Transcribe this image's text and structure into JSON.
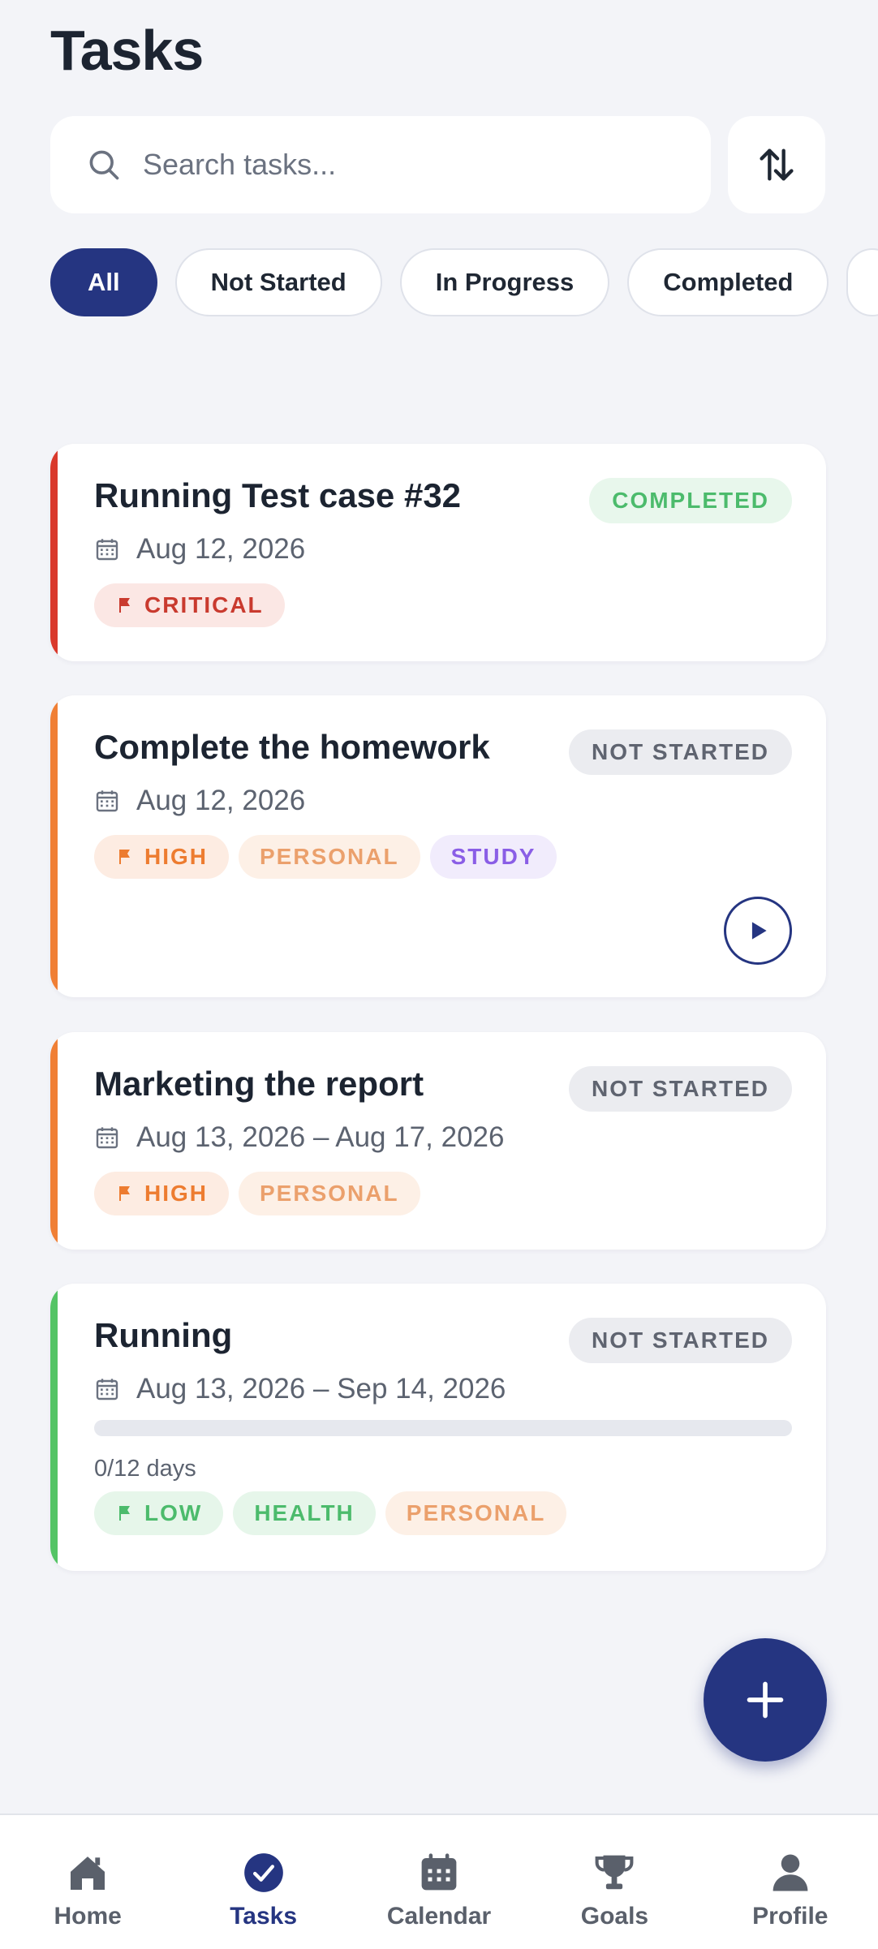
{
  "header": {
    "title": "Tasks"
  },
  "search": {
    "placeholder": "Search tasks...",
    "value": ""
  },
  "filters": [
    {
      "label": "All",
      "active": true
    },
    {
      "label": "Not Started",
      "active": false
    },
    {
      "label": "In Progress",
      "active": false
    },
    {
      "label": "Completed",
      "active": false
    }
  ],
  "tasks": [
    {
      "title": "Running Test case #32",
      "status": "COMPLETED",
      "date": "Aug 12, 2026",
      "accent": "#d9392c",
      "tags": [
        "CRITICAL"
      ]
    },
    {
      "title": "Complete the homework",
      "status": "NOT STARTED",
      "date": "Aug 12, 2026",
      "accent": "#f07f35",
      "tags": [
        "HIGH",
        "PERSONAL",
        "STUDY"
      ]
    },
    {
      "title": "Marketing the report",
      "status": "NOT STARTED",
      "date": "Aug 13, 2026 – Aug 17, 2026",
      "accent": "#f07f35",
      "tags": [
        "HIGH",
        "PERSONAL"
      ]
    },
    {
      "title": "Running",
      "status": "NOT STARTED",
      "date": "Aug 13, 2026 – Sep 14, 2026",
      "accent": "#54c465",
      "progress_text": "0/12 days",
      "progress_fraction": 0,
      "tags": [
        "LOW",
        "HEALTH",
        "PERSONAL"
      ]
    }
  ],
  "nav": [
    {
      "label": "Home",
      "icon": "home-icon",
      "active": false
    },
    {
      "label": "Tasks",
      "icon": "check-circle-icon",
      "active": true
    },
    {
      "label": "Calendar",
      "icon": "calendar-icon",
      "active": false
    },
    {
      "label": "Goals",
      "icon": "trophy-icon",
      "active": false
    },
    {
      "label": "Profile",
      "icon": "person-icon",
      "active": false
    }
  ],
  "colors": {
    "primary": "#253581",
    "background": "#f3f4f8",
    "critical": "#d9392c",
    "high": "#f07f35",
    "low": "#54c465"
  }
}
